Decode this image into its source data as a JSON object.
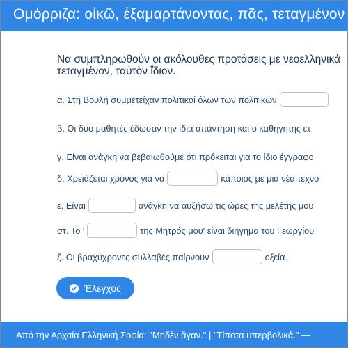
{
  "header": {
    "title": "Ομόρριζα: οἰκῶ, ἐξαμαρτάνοντας, πᾶς, τεταγμένον"
  },
  "instructions": {
    "line1": "Να συμπληρωθούν οι ακόλουθες προτάσεις με νεοελληνικά",
    "line2": "τεταγμένον, ταὐτὸν ἴδιον."
  },
  "exercise": {
    "a": {
      "before": "α. Στη Βουλή συμμετείχαν πολιτικοί όλων των πολιτικών",
      "value": "",
      "after": ""
    },
    "b": {
      "before": "β. Οι δύο μαθητές έδωσαν την ίδια απάντηση και ο καθηγητής ετ"
    },
    "c": {
      "before": "γ. Είναι ανάγκη να βεβαιωθούμε ότι πρόκειται για το ίδιο έγγραφο"
    },
    "d": {
      "before": "δ. Χρειάζεται χρόνος για να",
      "value": "",
      "after": "κάποιος με μια νέα τεχνο"
    },
    "e": {
      "before": "ε. Είναι",
      "value": "",
      "after": "ανάγκη να αυξήσω τις ώρες της μελέτης μου"
    },
    "f": {
      "before": "στ. Το '",
      "value": "",
      "after": "της Μητρός μου' είναι διήγημα του Γεωργίου"
    },
    "g": {
      "before": "ζ. Οι βραχύχρονες συλλαβές παίρνουν",
      "value": "",
      "after": "οξεία."
    }
  },
  "check_button": {
    "label": "Έλεγχος",
    "icon": "check-circle-icon"
  },
  "footer": {
    "text": "Από την Αρχαία Ελληνική Σοφία: \"Μηδὲν ἄγαν.\" | \"Τίποτα υπερβολικά.\" —"
  },
  "colors": {
    "accent": "#2f86e4",
    "text": "#1f3b5c",
    "border": "#b9c3cf"
  }
}
